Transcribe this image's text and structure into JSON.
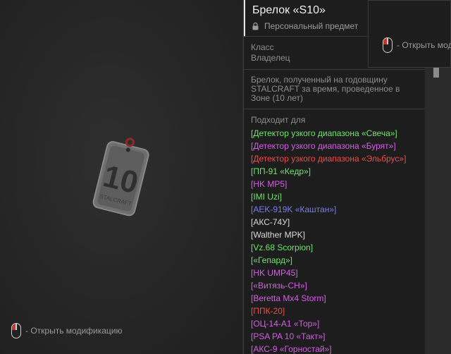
{
  "item": {
    "title": "Брелок «S10»",
    "subtitle": "Персональный предмет"
  },
  "details": {
    "class_label": "Класс",
    "owner_label": "Владелец",
    "description": "Брелок, полученный на годовщину STALCRAFT за время, проведенное в Зоне (10 лет)"
  },
  "fits": {
    "title": "Подходит для",
    "items": [
      {
        "label": "[Детектор узкого диапазона «Свеча»]",
        "color": "#6fe36f"
      },
      {
        "label": "[Детектор узкого диапазона «Бурят»]",
        "color": "#d35fe3"
      },
      {
        "label": "[Детектор узкого диапазона «Эльбрус»]",
        "color": "#f04a4a"
      },
      {
        "label": "[ПП-91 «Кедр»]",
        "color": "#6fe36f"
      },
      {
        "label": "[HK MP5]",
        "color": "#d35fe3"
      },
      {
        "label": "[IMI Uzi]",
        "color": "#6fe36f"
      },
      {
        "label": "[AEK-919K «Каштан»]",
        "color": "#7b7be8"
      },
      {
        "label": "[АКС-74У]",
        "color": "#d8d8d8"
      },
      {
        "label": "[Walther MPK]",
        "color": "#d8d8d8"
      },
      {
        "label": "[Vz.68 Scorpion]",
        "color": "#6fe36f"
      },
      {
        "label": "[«Гепард»]",
        "color": "#6fe36f"
      },
      {
        "label": "[HK UMP45]",
        "color": "#d35fe3"
      },
      {
        "label": "[«Витязь-СН»]",
        "color": "#d35fe3"
      },
      {
        "label": "[Beretta Mx4 Storm]",
        "color": "#d35fe3"
      },
      {
        "label": "[ППК-20]",
        "color": "#f04a4a"
      },
      {
        "label": "[ОЦ-14-А1 «Тор»]",
        "color": "#d35fe3"
      },
      {
        "label": "[PSA PA 10 «Такт»]",
        "color": "#d35fe3"
      },
      {
        "label": "[АКС-9 «Горностай»]",
        "color": "#d35fe3"
      }
    ]
  },
  "hints": {
    "open_mod_left": "- Открыть модификацию",
    "open_mod_right": "- Открыть модиф"
  },
  "keychain": {
    "engraving": "10",
    "brand": "STALCRAFT"
  }
}
